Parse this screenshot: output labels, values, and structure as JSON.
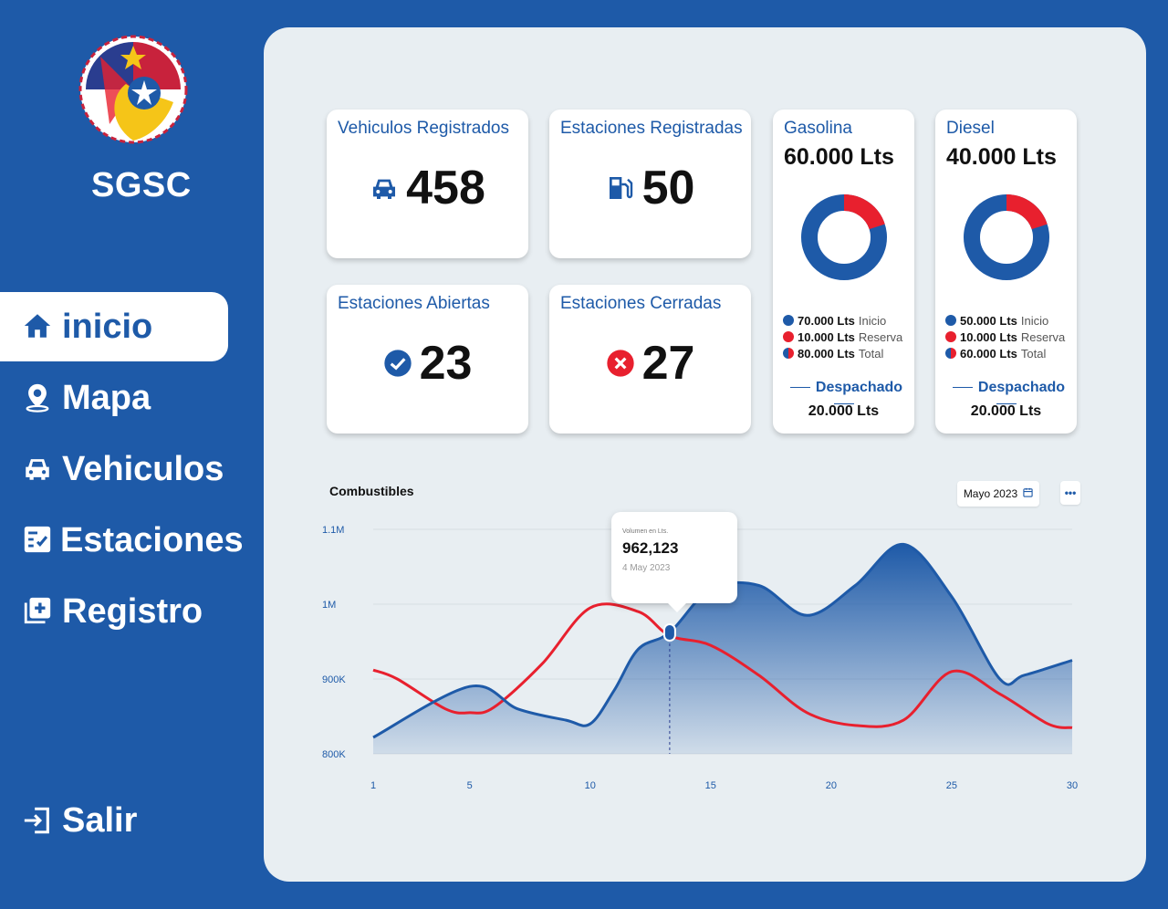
{
  "sidebar": {
    "brand": "SGSC",
    "nav": [
      {
        "label": "inicio",
        "icon": "home-icon"
      },
      {
        "label": "Mapa",
        "icon": "map-pin-icon"
      },
      {
        "label": "Vehiculos",
        "icon": "car-icon"
      },
      {
        "label": "Estaciones",
        "icon": "checklist-icon"
      },
      {
        "label": "Registro",
        "icon": "add-copy-icon"
      }
    ],
    "logout": {
      "label": "Salir",
      "icon": "logout-icon"
    }
  },
  "stats": [
    {
      "title": "Vehiculos Registrados",
      "value": "458",
      "icon": "car-icon"
    },
    {
      "title": "Estaciones Registradas",
      "value": "50",
      "icon": "fuel-pump-icon"
    },
    {
      "title": "Estaciones Abiertas",
      "value": "23",
      "icon": "check-circle-icon"
    },
    {
      "title": "Estaciones Cerradas",
      "value": "27",
      "icon": "x-circle-icon"
    }
  ],
  "fuels": [
    {
      "title": "Gasolina",
      "amount": "60.000 Lts",
      "used_fraction": 0.2,
      "legend": [
        {
          "value": "70.000 Lts",
          "label": "Inicio"
        },
        {
          "value": "10.000 Lts",
          "label": "Reserva"
        },
        {
          "value": "80.000 Lts",
          "label": "Total"
        }
      ],
      "dispatched_label": "Despachado",
      "dispatched_value": "20.000 Lts"
    },
    {
      "title": "Diesel",
      "amount": "40.000 Lts",
      "used_fraction": 0.2,
      "legend": [
        {
          "value": "50.000 Lts",
          "label": "Inicio"
        },
        {
          "value": "10.000 Lts",
          "label": "Reserva"
        },
        {
          "value": "60.000 Lts",
          "label": "Total"
        }
      ],
      "dispatched_label": "Despachado",
      "dispatched_value": "20.000 Lts"
    }
  ],
  "colors": {
    "blue": "#1e5aa8",
    "red": "#e8202e",
    "background": "#e8eef2"
  },
  "chart": {
    "title": "Combustibles",
    "date_filter": "Mayo 2023",
    "more_label": "•••",
    "tooltip": {
      "label": "Volumen en Lts.",
      "value": "962,123",
      "date": "4 May 2023"
    }
  },
  "chart_data": {
    "type": "area",
    "x_ticks": [
      "1",
      "5",
      "10",
      "15",
      "20",
      "25",
      "30"
    ],
    "y_ticks": [
      "1.1M",
      "1M",
      "900K",
      "800K"
    ],
    "xlim": [
      1,
      30
    ],
    "ylim": [
      800000,
      1100000
    ],
    "series": [
      {
        "color": "#1e5aa8",
        "points": [
          [
            1,
            822000
          ],
          [
            5,
            890000
          ],
          [
            7,
            860000
          ],
          [
            9,
            845000
          ],
          [
            10,
            840000
          ],
          [
            11,
            885000
          ],
          [
            12,
            940000
          ],
          [
            13.3,
            962123
          ],
          [
            15,
            1020000
          ],
          [
            17,
            1025000
          ],
          [
            19,
            985000
          ],
          [
            21,
            1025000
          ],
          [
            23,
            1080000
          ],
          [
            25,
            1010000
          ],
          [
            27,
            900000
          ],
          [
            28,
            905000
          ],
          [
            30,
            925000
          ]
        ]
      },
      {
        "color": "#e8202e",
        "points": [
          [
            1,
            912000
          ],
          [
            2,
            900000
          ],
          [
            4,
            860000
          ],
          [
            5,
            855000
          ],
          [
            6,
            862000
          ],
          [
            8,
            920000
          ],
          [
            10,
            995000
          ],
          [
            12,
            990000
          ],
          [
            13.3,
            958000
          ],
          [
            15,
            945000
          ],
          [
            17,
            905000
          ],
          [
            19,
            855000
          ],
          [
            21,
            838000
          ],
          [
            23,
            845000
          ],
          [
            25,
            910000
          ],
          [
            27,
            880000
          ],
          [
            29,
            840000
          ],
          [
            30,
            835000
          ]
        ]
      }
    ]
  }
}
